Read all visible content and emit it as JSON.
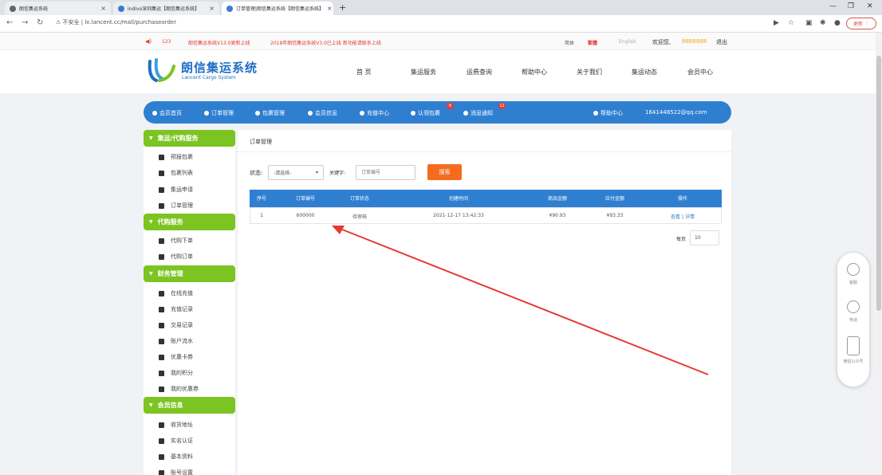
{
  "browser": {
    "tabs": [
      {
        "title": "朗信集运系统"
      },
      {
        "title": "indivo深圳集运【朗信集运系统】"
      },
      {
        "title": "订单管理|朗信集运系统【朗信集运系统】"
      }
    ],
    "url": "lx.lancent.cc/mall/purchaseorder",
    "not_secure": "不安全",
    "update_label": "更新"
  },
  "topstrip": {
    "phone": "123",
    "notice": "朗信集运系统V13.0更新上线",
    "notice2": "2018年朗信集运系统V3.0已上线 新功能请联系上线",
    "lang_cn": "简体",
    "lang_hk": "繁體",
    "lang_en": "English",
    "welcome": "欢迎您,",
    "user": "8888888",
    "logout": "退出"
  },
  "logo": {
    "cn": "朗信集运系统",
    "en": "Lancent Cargo System"
  },
  "main_nav": [
    "首  页",
    "集运服务",
    "运费查询",
    "帮助中心",
    "关于我们",
    "集运动态",
    "会员中心"
  ],
  "member_bar": {
    "items": [
      "会员首页",
      "订单管理",
      "包裹管理",
      "会员信息",
      "充值中心",
      "认领包裹",
      "消息通知"
    ],
    "badge1": "8",
    "badge2": "12",
    "help": "帮助中心",
    "email": "1641448522@qq.com"
  },
  "sidebar": {
    "groups": [
      {
        "title": "集运/代购服务",
        "items": [
          "预报包裹",
          "包裹列表",
          "集运申请",
          "订单管理"
        ]
      },
      {
        "title": "代购服务",
        "items": [
          "代购下单",
          "代购订单"
        ]
      },
      {
        "title": "财务管理",
        "items": [
          "在线充值",
          "充值记录",
          "交易记录",
          "账户流水",
          "优惠卡券",
          "我的积分",
          "我的优惠券"
        ]
      },
      {
        "title": "会员信息",
        "items": [
          "收货地址",
          "实名认证",
          "基本资料",
          "账号设置"
        ]
      }
    ]
  },
  "content": {
    "title": "订单管理",
    "status_label": "状态:",
    "status_value": "-请选择-",
    "keyword_label": "关键字:",
    "keyword_placeholder": "订单编号",
    "search_button": "搜索",
    "table": {
      "headers": [
        "序号",
        "订单编号",
        "订单状态",
        "创建时间",
        "商品金额",
        "应付金额",
        "操作"
      ],
      "rows": [
        {
          "index": "1",
          "order_no": "600000",
          "status": "待审核",
          "created": "2021-12-17 13:42:33",
          "goods": "¥90.93",
          "pay": "¥93.33",
          "op_view": "查看",
          "op_sep": "|",
          "op_detail": "详情"
        }
      ]
    },
    "page_label": "每页",
    "page_size": "10"
  },
  "float_panel": {
    "items": [
      "客服",
      "电话",
      "微信公众号"
    ]
  }
}
